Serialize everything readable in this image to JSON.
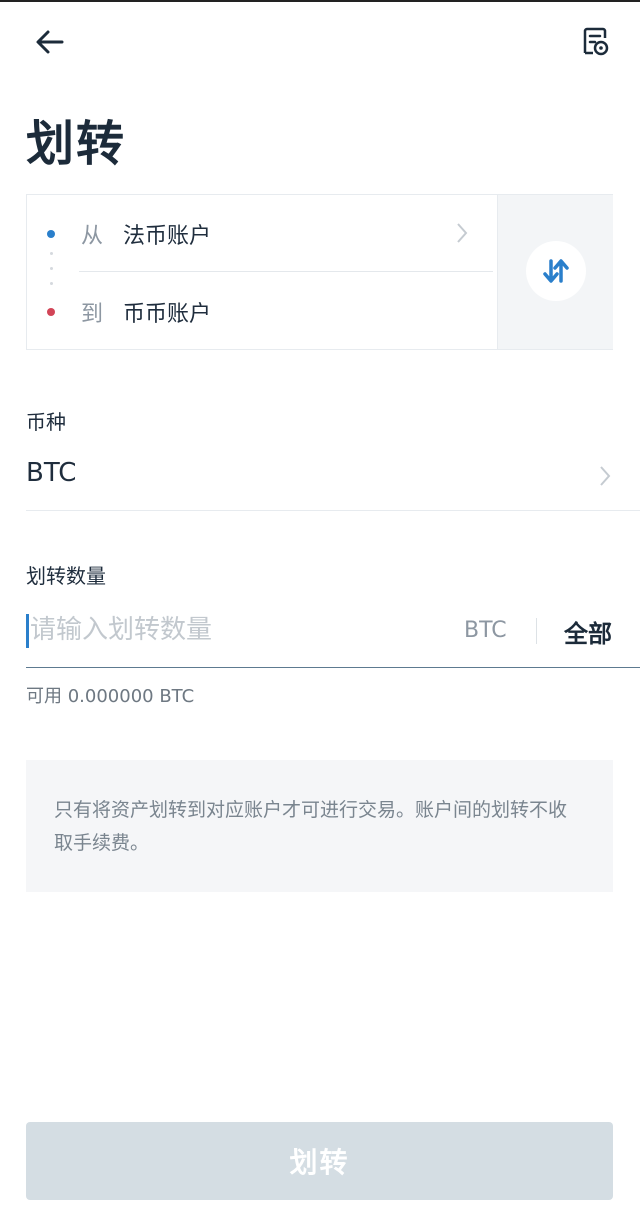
{
  "header": {
    "title": "划转"
  },
  "transfer": {
    "from_label": "从",
    "from_account": "法币账户",
    "to_label": "到",
    "to_account": "币币账户"
  },
  "currency": {
    "label": "币种",
    "value": "BTC"
  },
  "amount": {
    "label": "划转数量",
    "placeholder": "请输入划转数量",
    "unit": "BTC",
    "all_label": "全部",
    "available": "可用 0.000000 BTC"
  },
  "notice": {
    "text": "只有将资产划转到对应账户才可进行交易。账户间的划转不收取手续费。"
  },
  "submit": {
    "label": "划转"
  },
  "icons": {
    "back": "arrow-left-icon",
    "history": "transfer-record-icon",
    "swap": "swap-vertical-icon",
    "chevron": "chevron-right-icon"
  },
  "colors": {
    "accent_blue": "#2a7fcb",
    "accent_red": "#d24557",
    "button_disabled": "#d4dde3"
  }
}
